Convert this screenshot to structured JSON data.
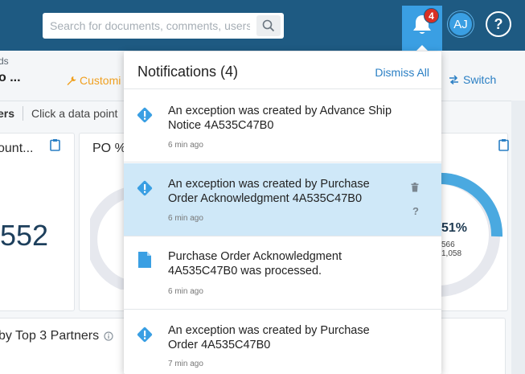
{
  "search": {
    "placeholder": "Search for documents, comments, users"
  },
  "header": {
    "notification_count": "4",
    "avatar_initials": "AJ",
    "help_label": "?"
  },
  "breadcrumb": {
    "small": "ds",
    "big": "o ..."
  },
  "toolbar": {
    "customize_label": "Customi",
    "switch_label": "Switch"
  },
  "filterbar": {
    "bold_label": "ers",
    "hint": "Click a data point"
  },
  "cards": [
    {
      "title": "ount...",
      "value": "552"
    },
    {
      "title": "PO %"
    },
    {
      "percent": "51%",
      "numerator": "566",
      "denominator": "1,058",
      "fraction": 0.51
    }
  ],
  "partners_title": "by Top 3 Partners",
  "notifications": {
    "title": "Notifications (4)",
    "dismiss_all": "Dismiss All",
    "items": [
      {
        "text": "An exception was created by Advance Ship Notice 4A535C47B0",
        "time": "6 min ago",
        "type": "exception"
      },
      {
        "text": "An exception was created by Purchase Order Acknowledgment 4A535C47B0",
        "time": "6 min ago",
        "type": "exception",
        "actions_help": "?"
      },
      {
        "text": "Purchase Order Acknowledgment 4A535C47B0 was processed.",
        "time": "6 min ago",
        "type": "document"
      },
      {
        "text": "An exception was created by Purchase Order 4A535C47B0",
        "time": "7 min ago",
        "type": "exception"
      }
    ]
  },
  "colors": {
    "topbar": "#1e5a82",
    "accent": "#3a9fe3",
    "badge": "#d93025",
    "highlight": "#cfe8f8",
    "warning": "#f0a020"
  }
}
